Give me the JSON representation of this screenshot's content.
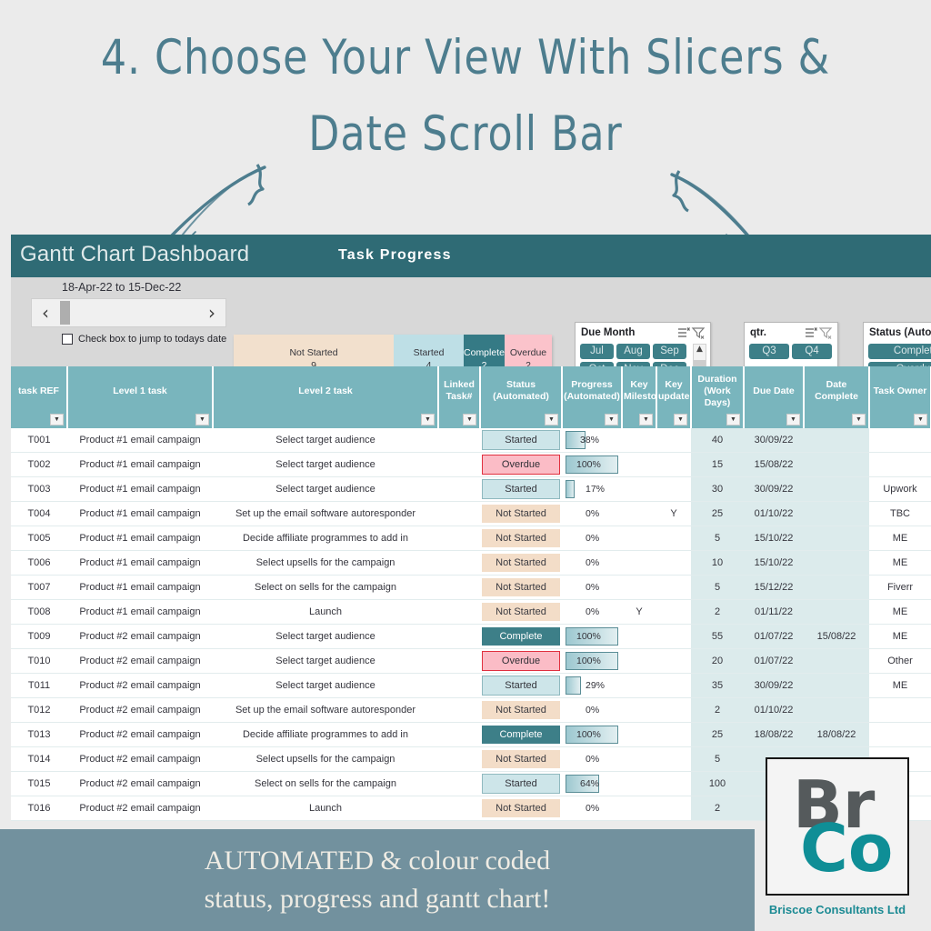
{
  "headline": {
    "line1": "4. Choose Your View With Slicers &",
    "line2": "Date Scroll Bar"
  },
  "titlebar": {
    "app_title": "Gantt Chart Dashboard",
    "section_title": "Task Progress"
  },
  "controls": {
    "date_range": "18-Apr-22 to 15-Dec-22",
    "scroll_left_glyph": "‹",
    "scroll_right_glyph": "›",
    "today_checkbox_label": "Check box to jump to todays date",
    "today_checkbox_checked": false
  },
  "summary": {
    "segments": [
      {
        "label": "Not Started",
        "value": "9",
        "color": "#f2e0cd"
      },
      {
        "label": "Started",
        "value": "4",
        "color": "#bedfe6"
      },
      {
        "label": "Complete",
        "value": "2",
        "color": "#357a85"
      },
      {
        "label": "Overdue",
        "value": "2",
        "color": "#fbc3cb"
      }
    ]
  },
  "slicers": [
    {
      "title": "Due Month",
      "buttons": [
        "Jul",
        "Aug",
        "Sep",
        "Oct",
        "Nov",
        "Dec"
      ],
      "has_scroll": true,
      "scroll_up_glyph": "▲",
      "scroll_down_glyph": "▼"
    },
    {
      "title": "qtr.",
      "buttons": [
        "Q3",
        "Q4"
      ],
      "has_scroll": false
    },
    {
      "title": "Status (Automated)",
      "buttons": [
        "Complete",
        "Overdue"
      ],
      "has_scroll": false
    }
  ],
  "table": {
    "columns": [
      "task REF",
      "Level 1 task",
      "Level 2 task",
      "Linked Task#",
      "Status (Automated)",
      "Progress (Automated)",
      "Key Milestone",
      "Key update",
      "Duration (Work Days)",
      "Due Date",
      "Date Complete",
      "Task Owner"
    ],
    "filter_glyph": "▼",
    "rows": [
      {
        "ref": "T001",
        "l1": "Product #1 email campaign",
        "l2": "Select target audience",
        "linked": "",
        "status": "Started",
        "progress": "38%",
        "pct": 38,
        "milestone": "",
        "update": "",
        "duration": "40",
        "due": "30/09/22",
        "complete": "",
        "owner": ""
      },
      {
        "ref": "T002",
        "l1": "Product #1 email campaign",
        "l2": "Select target audience",
        "linked": "",
        "status": "Overdue",
        "progress": "100%",
        "pct": 100,
        "milestone": "",
        "update": "",
        "duration": "15",
        "due": "15/08/22",
        "complete": "",
        "owner": ""
      },
      {
        "ref": "T003",
        "l1": "Product #1 email campaign",
        "l2": "Select target audience",
        "linked": "",
        "status": "Started",
        "progress": "17%",
        "pct": 17,
        "milestone": "",
        "update": "",
        "duration": "30",
        "due": "30/09/22",
        "complete": "",
        "owner": "Upwork"
      },
      {
        "ref": "T004",
        "l1": "Product #1 email campaign",
        "l2": "Set up the email software autoresponder",
        "linked": "",
        "status": "Not Started",
        "progress": "0%",
        "pct": 0,
        "milestone": "",
        "update": "Y",
        "duration": "25",
        "due": "01/10/22",
        "complete": "",
        "owner": "TBC"
      },
      {
        "ref": "T005",
        "l1": "Product #1 email campaign",
        "l2": "Decide affiliate programmes to add in",
        "linked": "",
        "status": "Not Started",
        "progress": "0%",
        "pct": 0,
        "milestone": "",
        "update": "",
        "duration": "5",
        "due": "15/10/22",
        "complete": "",
        "owner": "ME"
      },
      {
        "ref": "T006",
        "l1": "Product #1 email campaign",
        "l2": "Select upsells for the campaign",
        "linked": "",
        "status": "Not Started",
        "progress": "0%",
        "pct": 0,
        "milestone": "",
        "update": "",
        "duration": "10",
        "due": "15/10/22",
        "complete": "",
        "owner": "ME"
      },
      {
        "ref": "T007",
        "l1": "Product #1 email campaign",
        "l2": "Select on sells for the campaign",
        "linked": "",
        "status": "Not Started",
        "progress": "0%",
        "pct": 0,
        "milestone": "",
        "update": "",
        "duration": "5",
        "due": "15/12/22",
        "complete": "",
        "owner": "Fiverr"
      },
      {
        "ref": "T008",
        "l1": "Product #1 email campaign",
        "l2": "Launch",
        "linked": "",
        "status": "Not Started",
        "progress": "0%",
        "pct": 0,
        "milestone": "Y",
        "update": "",
        "duration": "2",
        "due": "01/11/22",
        "complete": "",
        "owner": "ME"
      },
      {
        "ref": "T009",
        "l1": "Product #2 email campaign",
        "l2": "Select target audience",
        "linked": "",
        "status": "Complete",
        "progress": "100%",
        "pct": 100,
        "milestone": "",
        "update": "",
        "duration": "55",
        "due": "01/07/22",
        "complete": "15/08/22",
        "owner": "ME"
      },
      {
        "ref": "T010",
        "l1": "Product #2 email campaign",
        "l2": "Select target audience",
        "linked": "",
        "status": "Overdue",
        "progress": "100%",
        "pct": 100,
        "milestone": "",
        "update": "",
        "duration": "20",
        "due": "01/07/22",
        "complete": "",
        "owner": "Other"
      },
      {
        "ref": "T011",
        "l1": "Product #2 email campaign",
        "l2": "Select target audience",
        "linked": "",
        "status": "Started",
        "progress": "29%",
        "pct": 29,
        "milestone": "",
        "update": "",
        "duration": "35",
        "due": "30/09/22",
        "complete": "",
        "owner": "ME"
      },
      {
        "ref": "T012",
        "l1": "Product #2 email campaign",
        "l2": "Set up the email software autoresponder",
        "linked": "",
        "status": "Not Started",
        "progress": "0%",
        "pct": 0,
        "milestone": "",
        "update": "",
        "duration": "2",
        "due": "01/10/22",
        "complete": "",
        "owner": ""
      },
      {
        "ref": "T013",
        "l1": "Product #2 email campaign",
        "l2": "Decide affiliate programmes to add in",
        "linked": "",
        "status": "Complete",
        "progress": "100%",
        "pct": 100,
        "milestone": "",
        "update": "",
        "duration": "25",
        "due": "18/08/22",
        "complete": "18/08/22",
        "owner": ""
      },
      {
        "ref": "T014",
        "l1": "Product #2 email campaign",
        "l2": "Select upsells for the campaign",
        "linked": "",
        "status": "Not Started",
        "progress": "0%",
        "pct": 0,
        "milestone": "",
        "update": "",
        "duration": "5",
        "due": "",
        "complete": "",
        "owner": ""
      },
      {
        "ref": "T015",
        "l1": "Product #2 email campaign",
        "l2": "Select on sells for the campaign",
        "linked": "",
        "status": "Started",
        "progress": "64%",
        "pct": 64,
        "milestone": "",
        "update": "",
        "duration": "100",
        "due": "",
        "complete": "",
        "owner": ""
      },
      {
        "ref": "T016",
        "l1": "Product #2 email campaign",
        "l2": "Launch",
        "linked": "",
        "status": "Not Started",
        "progress": "0%",
        "pct": 0,
        "milestone": "",
        "update": "",
        "duration": "2",
        "due": "",
        "complete": "",
        "owner": ""
      }
    ]
  },
  "banner": {
    "line1": "AUTOMATED & colour coded",
    "line2": "status, progress and gantt chart!"
  },
  "logo": {
    "mark_top": "Br",
    "mark_bottom": "Co",
    "caption": "Briscoe Consultants Ltd"
  },
  "colors": {
    "brand_teal": "#2f6b75",
    "header_teal": "#79b5bd",
    "banner_blue": "#72919e",
    "page_bg": "#ebebeb",
    "status_not_started": "#f3ddc8",
    "status_started": "#cde5e9",
    "status_complete": "#3d7f88",
    "status_overdue": "#fbbcc6"
  }
}
